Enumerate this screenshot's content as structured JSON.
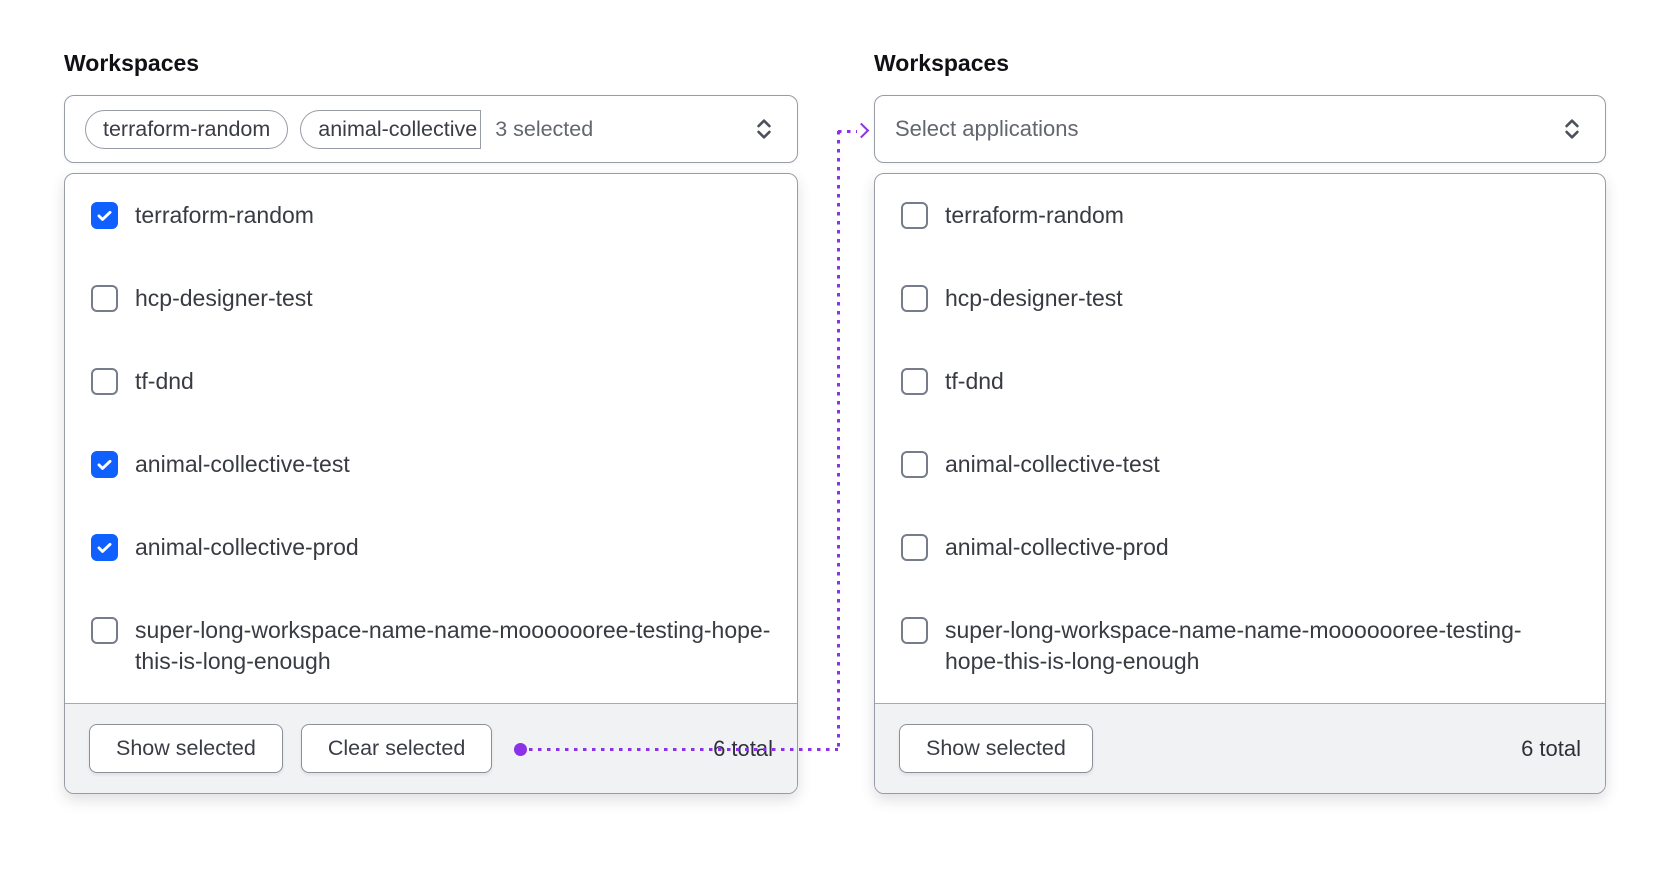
{
  "colors": {
    "accent_blue": "#1060ff",
    "connector_purple": "#8d31e8",
    "border_strong": "#979ca7",
    "footer_bg": "#f1f2f4"
  },
  "left": {
    "label": "Workspaces",
    "trigger": {
      "tags": [
        "terraform-random",
        "animal-collective"
      ],
      "selected_count_text": "3 selected",
      "chevron_icon": "unfold-chevron"
    },
    "options": [
      {
        "label": "terraform-random",
        "checked": true
      },
      {
        "label": "hcp-designer-test",
        "checked": false
      },
      {
        "label": "tf-dnd",
        "checked": false
      },
      {
        "label": "animal-collective-test",
        "checked": true
      },
      {
        "label": "animal-collective-prod",
        "checked": true
      },
      {
        "label": "super-long-workspace-name-name-mooooooree-testing-hope-this-is-long-enough",
        "checked": false
      }
    ],
    "footer": {
      "show_selected": "Show selected",
      "clear_selected": "Clear selected",
      "total": "6 total"
    }
  },
  "right": {
    "label": "Workspaces",
    "trigger": {
      "placeholder": "Select applications",
      "chevron_icon": "unfold-chevron"
    },
    "options": [
      {
        "label": "terraform-random",
        "checked": false
      },
      {
        "label": "hcp-designer-test",
        "checked": false
      },
      {
        "label": "tf-dnd",
        "checked": false
      },
      {
        "label": "animal-collective-test",
        "checked": false
      },
      {
        "label": "animal-collective-prod",
        "checked": false
      },
      {
        "label": "super-long-workspace-name-name-mooooooree-testing-hope-this-is-long-enough",
        "checked": false
      }
    ],
    "footer": {
      "show_selected": "Show selected",
      "total": "6 total"
    }
  }
}
